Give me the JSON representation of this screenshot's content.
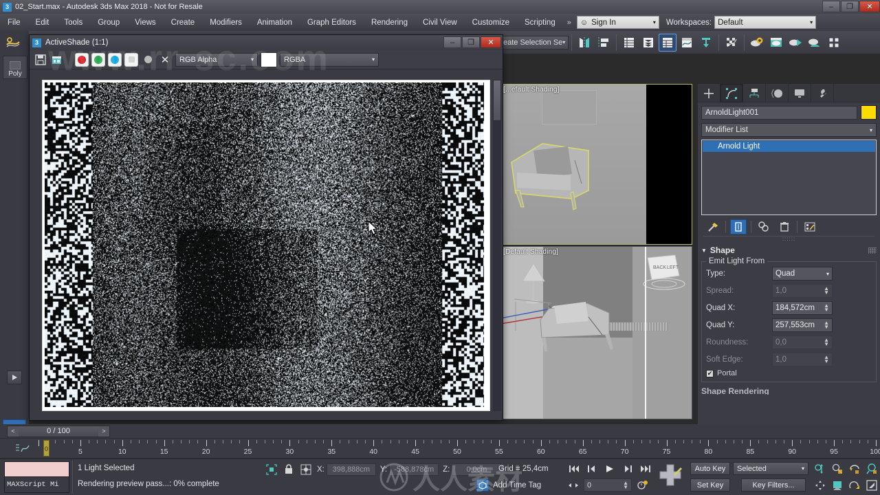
{
  "window": {
    "title": "02_Start.max - Autodesk 3ds Max 2018 - Not for Resale",
    "app_icon": "3",
    "minimize": "–",
    "maximize": "❐",
    "close": "✕"
  },
  "menubar": {
    "items": [
      "File",
      "Edit",
      "Tools",
      "Group",
      "Views",
      "Create",
      "Modifiers",
      "Animation",
      "Graph Editors",
      "Rendering",
      "Civil View",
      "Customize",
      "Scripting"
    ],
    "overflow": "»",
    "signin_label": "Sign In",
    "workspaces_label": "Workspaces:",
    "workspace_value": "Default",
    "caret": "▾"
  },
  "toolbar": {
    "selection_set_placeholder": "eate Selection Se",
    "caret": "▾",
    "icons": [
      "mirror-icon",
      "align-icon",
      "layer-explorer-icon",
      "layer-manager-icon",
      "curve-editor-icon",
      "schematic-view-icon",
      "material-editor-icon",
      "particle-view-icon",
      "render-setup-icon",
      "rendered-frame-window-icon",
      "render-production-icon",
      "render-iterative-icon",
      "render-in-cloud-icon"
    ]
  },
  "leftbar": {
    "ribbon_icon": "ribbon-icon",
    "poly_label": "Poly",
    "play_icon": "play-icon",
    "grid_icon": "grid-icon"
  },
  "activeshade": {
    "title": "ActiveShade (1:1)",
    "icon": "3",
    "minimize": "–",
    "maximize": "❐",
    "close": "✕",
    "toolbar": {
      "save_icon": "save-icon",
      "clone_icon": "clone-render-icon",
      "channel_red": "red-channel-icon",
      "channel_green": "green-channel-icon",
      "channel_blue": "blue-channel-icon",
      "channel_alpha": "alpha-channel-icon",
      "channel_mono": "mono-channel-icon",
      "clear_icon": "clear-icon",
      "layer_dropdown": "RGB Alpha",
      "channel_dropdown": "RGBA",
      "caret": "▾"
    }
  },
  "viewports": {
    "top_label": "[...efault Shading]",
    "bottom_label": "[Default Shading]",
    "viewcube_back": "BACK",
    "viewcube_left": "LEFT"
  },
  "command_panel": {
    "tabs": [
      "create-tab",
      "modify-tab",
      "hierarchy-tab",
      "motion-tab",
      "display-tab",
      "utilities-tab"
    ],
    "selected_tab_index": 1,
    "object_name": "ArnoldLight001",
    "object_color": "#fcdb00",
    "modifier_list_label": "Modifier List",
    "caret": "▾",
    "stack": [
      {
        "label": "Arnold Light",
        "selected": true
      }
    ],
    "stack_tools": [
      "pin-stack-icon",
      "show-end-result-icon",
      "make-unique-icon",
      "remove-modifier-icon",
      "configure-sets-icon"
    ],
    "rollout": {
      "title": "Shape",
      "group_title": "Emit Light From",
      "rows": [
        {
          "label": "Type:",
          "value": "Quad",
          "kind": "dropdown",
          "disabled": false
        },
        {
          "label": "Spread:",
          "value": "1,0",
          "kind": "spinner",
          "disabled": true
        },
        {
          "label": "Quad X:",
          "value": "184,572cm",
          "kind": "spinner",
          "disabled": false
        },
        {
          "label": "Quad Y:",
          "value": "257,553cm",
          "kind": "spinner",
          "disabled": false
        },
        {
          "label": "Roundness:",
          "value": "0,0",
          "kind": "spinner",
          "disabled": true
        },
        {
          "label": "Soft Edge:",
          "value": "1,0",
          "kind": "spinner",
          "disabled": true
        }
      ],
      "checkbox_label": "Portal",
      "checkbox_checked": true,
      "check_glyph": "✔",
      "next_rollout": "Shape Rendering"
    }
  },
  "time_slider": {
    "value": "0 / 100",
    "prev": "<",
    "next": ">"
  },
  "track_bar": {
    "curve_icon": "curve-editor-icon",
    "tick_labels": [
      "5",
      "10",
      "15",
      "20",
      "25",
      "30",
      "35",
      "40",
      "45",
      "50",
      "55",
      "60",
      "65",
      "70",
      "75",
      "80",
      "85",
      "90",
      "95",
      "100"
    ],
    "playhead_label": "0",
    "range_start": 0,
    "range_end": 100
  },
  "status_bar": {
    "mini_listener_label": "MAXScript Mi",
    "selection_status": "1 Light Selected",
    "progress_status": "Rendering preview pass...: 0% complete",
    "lock_icon": "lock-selection-icon",
    "sel-lock-icon": "selection-lock-icon",
    "absolute_mode_icon": "absolute-relative-icon",
    "coords": [
      {
        "label": "X:",
        "value": "398,888cm"
      },
      {
        "label": "Y:",
        "value": "-588,878cm"
      },
      {
        "label": "Z:",
        "value": "0,0cm"
      }
    ],
    "grid_text": "Grid = 25,4cm",
    "add_time_tag": "Add Time Tag",
    "transport": [
      "go-to-start-icon",
      "previous-frame-icon",
      "play-animation-icon",
      "next-frame-icon",
      "go-to-end-icon"
    ],
    "frame_value": "0",
    "key_mode_icon": "key-mode-toggle-icon",
    "set_key_icon": "set-key-icon",
    "auto_key_label": "Auto Key",
    "set_key_label": "Set Key",
    "key_selection": "Selected",
    "key_filters_label": "Key Filters...",
    "caret": "▾",
    "viewport_nav": [
      "zoom-icon",
      "zoom-all-icon",
      "zoom-extents-icon",
      "zoom-region-icon",
      "pan-icon",
      "orbit-icon",
      "field-of-view-icon",
      "maximize-viewport-icon"
    ]
  },
  "watermarks": {
    "site": "www.rr-sc.com",
    "brand": "人人素材"
  }
}
